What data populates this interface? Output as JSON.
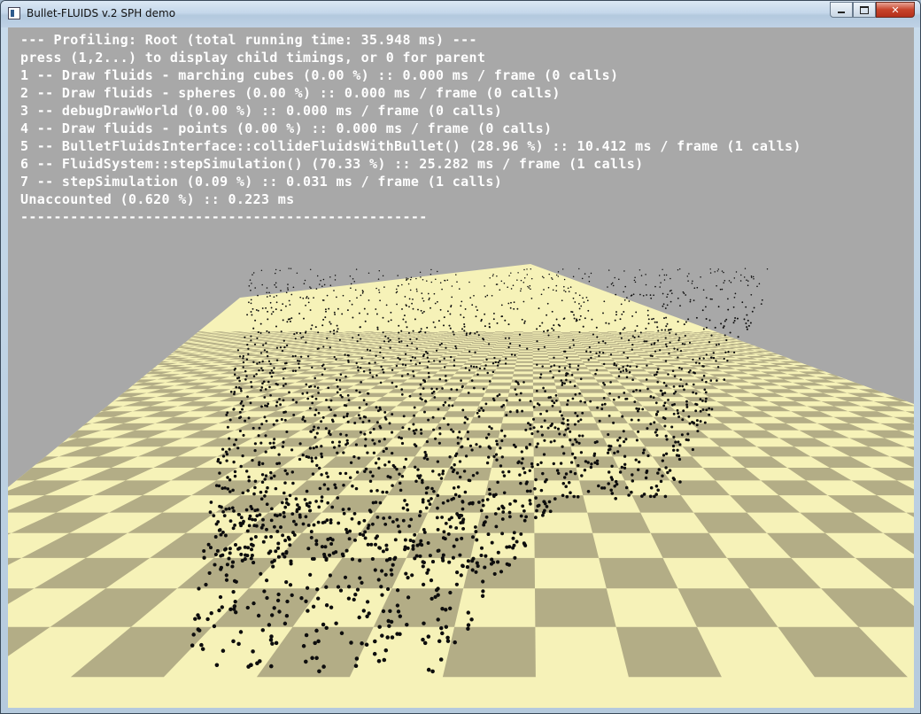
{
  "window": {
    "title": "Bullet-FLUIDS v.2 SPH demo",
    "close_glyph": "✕",
    "app_icon": "window-app-icon"
  },
  "profiler": {
    "lines": [
      "--- Profiling: Root (total running time: 35.948 ms) ---",
      "press (1,2...) to display child timings, or 0 for parent",
      "1 -- Draw fluids - marching cubes (0.00 %) :: 0.000 ms / frame (0 calls)",
      "2 -- Draw fluids - spheres (0.00 %) :: 0.000 ms / frame (0 calls)",
      "3 -- debugDrawWorld (0.00 %) :: 0.000 ms / frame (0 calls)",
      "4 -- Draw fluids - points (0.00 %) :: 0.000 ms / frame (0 calls)",
      "5 -- BulletFluidsInterface::collideFluidsWithBullet() (28.96 %) :: 10.412 ms / frame (1 calls)",
      "6 -- FluidSystem::stepSimulation() (70.33 %) :: 25.282 ms / frame (1 calls)",
      "7 -- stepSimulation (0.09 %) :: 0.031 ms / frame (1 calls)",
      "Unaccounted (0.620 %) :: 0.223 ms",
      "-------------------------------------------------"
    ]
  },
  "scene": {
    "background_color": "#a8a8a8",
    "floor_light_color": "#f6f2b8",
    "floor_dark_color": "#b3ad86",
    "particle_color": "#0d0d0d"
  }
}
